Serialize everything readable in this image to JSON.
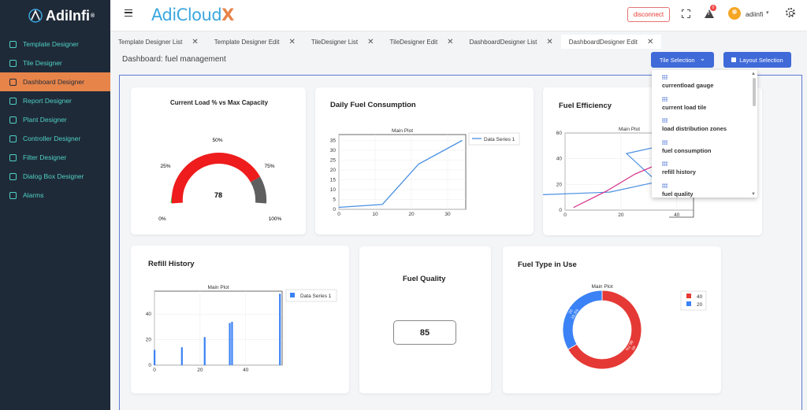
{
  "app": {
    "logo_text": "AdiInfi",
    "logo_reg": "®",
    "brand_name": "AdiCloud",
    "brand_x": "X"
  },
  "sidebar": {
    "items": [
      {
        "label": "Template Designer",
        "icon": "layers-icon"
      },
      {
        "label": "Tile Designer",
        "icon": "grid-icon"
      },
      {
        "label": "Dashboard Designer",
        "icon": "dashboard-icon"
      },
      {
        "label": "Report Designer",
        "icon": "report-icon"
      },
      {
        "label": "Plant Designer",
        "icon": "plant-icon"
      },
      {
        "label": "Controller Designer",
        "icon": "controller-icon"
      },
      {
        "label": "Filter Designer",
        "icon": "filter-icon"
      },
      {
        "label": "Dialog Box Designer",
        "icon": "dialog-icon"
      },
      {
        "label": "Alarms",
        "icon": "alarm-icon"
      }
    ],
    "active_index": 2
  },
  "header": {
    "disconnect_label": "disconnect",
    "notification_count": "0",
    "username": "adiinfi",
    "caret": "▾"
  },
  "tabs": [
    {
      "label": "Template Designer List"
    },
    {
      "label": "Template Designer Edit"
    },
    {
      "label": "TileDesigner List"
    },
    {
      "label": "TileDesigner Edit"
    },
    {
      "label": "DashboardDesigner List"
    },
    {
      "label": "DashboardDesigner Edit"
    }
  ],
  "tab_close": "✕",
  "page": {
    "title": "Dashboard: fuel management",
    "tile_selection_label": "Tile Selection",
    "tile_selection_caret": "⌄",
    "layout_selection_label": "Layout Selection"
  },
  "tile_dropdown": {
    "items": [
      "currentload gauge",
      "current load tile",
      "load distribution zones",
      "fuel consumption",
      "refill history",
      "fuel quality"
    ]
  },
  "cards": {
    "gauge": {
      "title": "Current Load % vs Max Capacity",
      "value": "78",
      "labels": [
        "0%",
        "25%",
        "50%",
        "75%",
        "100%"
      ]
    },
    "daily": {
      "title": "Daily Fuel Consumption"
    },
    "efficiency": {
      "title": "Fuel Efficiency"
    },
    "refill": {
      "title": "Refill History"
    },
    "quality": {
      "title": "Fuel Quality",
      "value": "85"
    },
    "fueltype": {
      "title": "Fuel Type in Use"
    }
  },
  "colors": {
    "accent": "#3f6ad8",
    "sidebar_bg": "#1f2a38",
    "nav_text": "#4fd1c5",
    "active_nav": "#e7844a",
    "gauge_red": "#ee1c1c",
    "donut_red": "#e53935",
    "donut_blue": "#3b82f6"
  },
  "chart_data": [
    {
      "type": "line",
      "title": "Main Plot",
      "series": [
        {
          "name": "Data Series 1",
          "x": [
            0,
            12,
            22,
            34
          ],
          "y": [
            1,
            2.5,
            23,
            35
          ]
        }
      ],
      "xlim": [
        0,
        35
      ],
      "ylim": [
        0,
        38
      ],
      "xticks": [
        0,
        10,
        20,
        30
      ],
      "yticks": [
        0,
        5,
        10,
        15,
        20,
        25,
        30,
        35
      ]
    },
    {
      "type": "line",
      "title": "Main Plot",
      "series": [
        {
          "x": [
            0,
            22,
            33,
            45
          ],
          "y": [
            12,
            14,
            22,
            55
          ]
        },
        {
          "x": [
            3,
            15,
            25,
            40
          ],
          "y": [
            2,
            15,
            28,
            42
          ]
        }
      ],
      "xlim": [
        0,
        46
      ],
      "ylim": [
        0,
        60
      ],
      "xticks": [
        0,
        20,
        40
      ],
      "yticks": [
        0,
        20,
        40,
        60
      ]
    },
    {
      "type": "bar",
      "title": "Main Plot",
      "series": [
        {
          "name": "Data Series 1",
          "x": [
            0,
            12,
            22,
            33,
            34,
            55
          ],
          "values": [
            12,
            14,
            22,
            33,
            34,
            56
          ]
        }
      ],
      "xlim": [
        0,
        56
      ],
      "ylim": [
        0,
        58
      ],
      "xticks": [
        0,
        20,
        40
      ],
      "yticks": [
        0,
        20,
        40
      ]
    },
    {
      "type": "pie",
      "title": "Main Plot",
      "series": [
        {
          "labels": [
            "40",
            "20"
          ],
          "values": [
            40,
            20
          ],
          "percent_labels": [
            "66.7%",
            "33.3%"
          ]
        }
      ]
    }
  ]
}
